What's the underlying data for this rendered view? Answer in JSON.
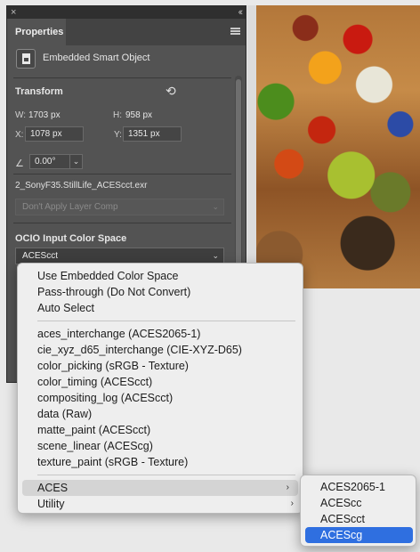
{
  "panel": {
    "close_glyph": "×",
    "collapse_glyph": "‹‹",
    "tab_label": "Properties",
    "object_type": "Embedded Smart Object",
    "transform": {
      "title": "Transform",
      "w_label": "W:",
      "w_value": "1703 px",
      "h_label": "H:",
      "h_value": "958 px",
      "x_label": "X:",
      "x_value": "1078 px",
      "y_label": "Y:",
      "y_value": "1351 px",
      "angle_value": "0.00°"
    },
    "filename": "2_SonyF35.StillLife_ACEScct.exr",
    "layer_comp": "Don't Apply Layer Comp",
    "ocio_title": "OCIO Input Color Space",
    "ocio_value": "ACEScct"
  },
  "menu": {
    "group1": [
      "Use Embedded Color Space",
      "Pass-through (Do Not Convert)",
      "Auto Select"
    ],
    "group2": [
      "aces_interchange (ACES2065-1)",
      "cie_xyz_d65_interchange (CIE-XYZ-D65)",
      "color_picking (sRGB - Texture)",
      "color_timing (ACEScct)",
      "compositing_log (ACEScct)",
      "data (Raw)",
      "matte_paint (ACEScct)",
      "scene_linear (ACEScg)",
      "texture_paint (sRGB - Texture)"
    ],
    "group3": [
      "ACES",
      "Utility"
    ],
    "submenu_arrow": "›"
  },
  "submenu": {
    "items": [
      "ACES2065-1",
      "ACEScc",
      "ACEScct",
      "ACEScg"
    ],
    "selected": "ACEScg"
  },
  "colors": {
    "panel_bg": "#535353",
    "menu_bg": "#eeeeee",
    "selection_blue": "#2f6fe0"
  }
}
